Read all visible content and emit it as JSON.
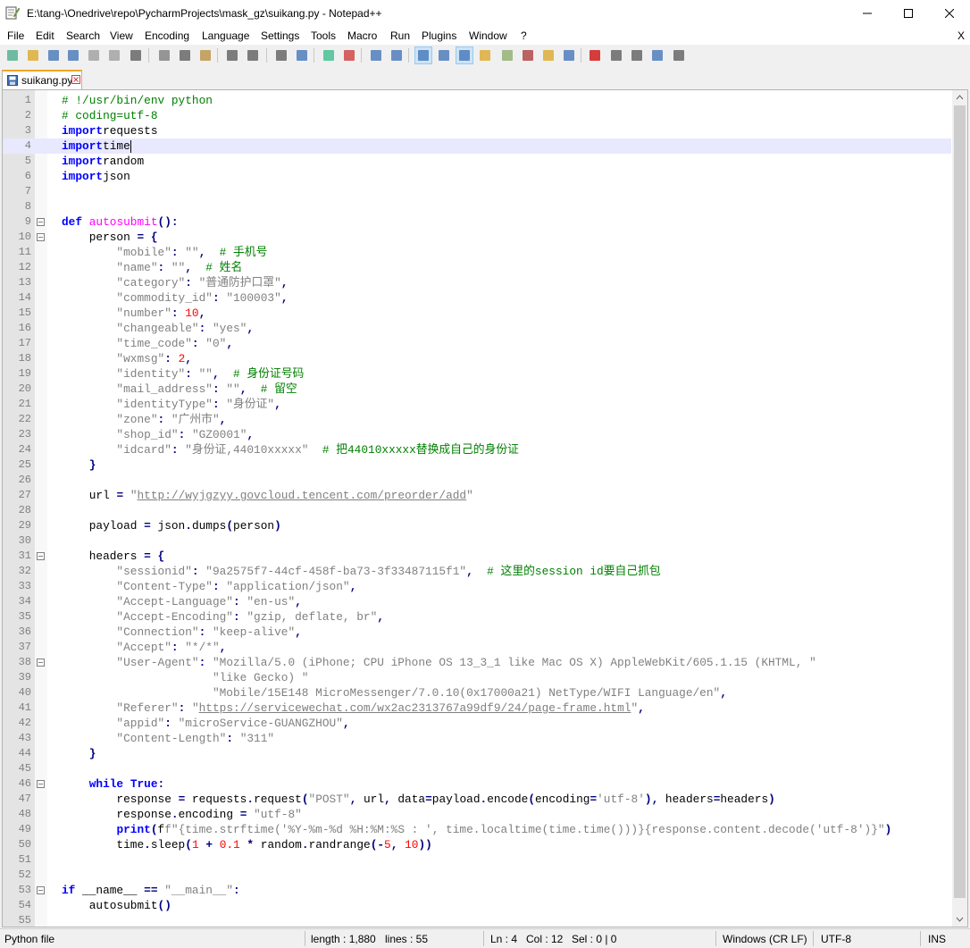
{
  "window": {
    "title": "E:\\tang-\\Onedrive\\repo\\PycharmProjects\\mask_gz\\suikang.py - Notepad++",
    "minimize": "—",
    "maximize": "☐",
    "close": "✕"
  },
  "menu": {
    "items": [
      "File",
      "Edit",
      "Search",
      "View",
      "Encoding",
      "Language",
      "Settings",
      "Tools",
      "Macro",
      "Run",
      "Plugins",
      "Window",
      "?"
    ],
    "close": "X"
  },
  "toolbar": {
    "icons": [
      "new-file",
      "open-file",
      "save",
      "save-all",
      "close",
      "close-all",
      "print",
      "cut",
      "copy",
      "paste",
      "undo",
      "redo",
      "find",
      "replace",
      "zoom-in",
      "zoom-out",
      "sync-vertical",
      "sync-horizontal",
      "word-wrap",
      "show-all-characters",
      "indent-guide",
      "udl",
      "doc-map",
      "function-list",
      "folder-as-workspace",
      "monitoring",
      "record-macro",
      "stop-recording",
      "playback",
      "run-macro-multiple",
      "save-macro"
    ],
    "active_icons": [
      "word-wrap",
      "indent-guide"
    ]
  },
  "tab": {
    "label": "suikang.py"
  },
  "editor": {
    "current_line": 4,
    "lines": [
      [
        [
          "cm",
          "# !/usr/bin/env python"
        ]
      ],
      [
        [
          "cm",
          "# coding=utf-8"
        ]
      ],
      [
        [
          "kw",
          "import"
        ],
        [
          "",
          "requests"
        ]
      ],
      [
        [
          "kw",
          "import"
        ],
        [
          "",
          "time"
        ]
      ],
      [
        [
          "kw",
          "import"
        ],
        [
          "",
          "random"
        ]
      ],
      [
        [
          "kw",
          "import"
        ],
        [
          "",
          "json"
        ]
      ],
      [],
      [],
      [
        [
          "kw",
          "def"
        ],
        [
          "",
          " "
        ],
        [
          "fn",
          "autosubmit"
        ],
        [
          "op",
          "():"
        ]
      ],
      [
        [
          "",
          "    person "
        ],
        [
          "op",
          "="
        ],
        [
          "",
          " "
        ],
        [
          "op",
          "{"
        ]
      ],
      [
        [
          "st",
          "        \"mobile\""
        ],
        [
          "op",
          ":"
        ],
        [
          "",
          " "
        ],
        [
          "st",
          "\"\""
        ],
        [
          "op",
          ","
        ],
        [
          "",
          "  "
        ],
        [
          "cm",
          "# 手机号"
        ]
      ],
      [
        [
          "st",
          "        \"name\""
        ],
        [
          "op",
          ":"
        ],
        [
          "",
          " "
        ],
        [
          "st",
          "\"\""
        ],
        [
          "op",
          ","
        ],
        [
          "",
          "  "
        ],
        [
          "cm",
          "# 姓名"
        ]
      ],
      [
        [
          "st",
          "        \"category\""
        ],
        [
          "op",
          ":"
        ],
        [
          "",
          " "
        ],
        [
          "st",
          "\"普通防护口罩\""
        ],
        [
          "op",
          ","
        ]
      ],
      [
        [
          "st",
          "        \"commodity_id\""
        ],
        [
          "op",
          ":"
        ],
        [
          "",
          " "
        ],
        [
          "st",
          "\"100003\""
        ],
        [
          "op",
          ","
        ]
      ],
      [
        [
          "st",
          "        \"number\""
        ],
        [
          "op",
          ":"
        ],
        [
          "",
          " "
        ],
        [
          "nm",
          "10"
        ],
        [
          "op",
          ","
        ]
      ],
      [
        [
          "st",
          "        \"changeable\""
        ],
        [
          "op",
          ":"
        ],
        [
          "",
          " "
        ],
        [
          "st",
          "\"yes\""
        ],
        [
          "op",
          ","
        ]
      ],
      [
        [
          "st",
          "        \"time_code\""
        ],
        [
          "op",
          ":"
        ],
        [
          "",
          " "
        ],
        [
          "st",
          "\"0\""
        ],
        [
          "op",
          ","
        ]
      ],
      [
        [
          "st",
          "        \"wxmsg\""
        ],
        [
          "op",
          ":"
        ],
        [
          "",
          " "
        ],
        [
          "nm",
          "2"
        ],
        [
          "op",
          ","
        ]
      ],
      [
        [
          "st",
          "        \"identity\""
        ],
        [
          "op",
          ":"
        ],
        [
          "",
          " "
        ],
        [
          "st",
          "\"\""
        ],
        [
          "op",
          ","
        ],
        [
          "",
          "  "
        ],
        [
          "cm",
          "# 身份证号码"
        ]
      ],
      [
        [
          "st",
          "        \"mail_address\""
        ],
        [
          "op",
          ":"
        ],
        [
          "",
          " "
        ],
        [
          "st",
          "\"\""
        ],
        [
          "op",
          ","
        ],
        [
          "",
          "  "
        ],
        [
          "cm",
          "# 留空"
        ]
      ],
      [
        [
          "st",
          "        \"identityType\""
        ],
        [
          "op",
          ":"
        ],
        [
          "",
          " "
        ],
        [
          "st",
          "\"身份证\""
        ],
        [
          "op",
          ","
        ]
      ],
      [
        [
          "st",
          "        \"zone\""
        ],
        [
          "op",
          ":"
        ],
        [
          "",
          " "
        ],
        [
          "st",
          "\"广州市\""
        ],
        [
          "op",
          ","
        ]
      ],
      [
        [
          "st",
          "        \"shop_id\""
        ],
        [
          "op",
          ":"
        ],
        [
          "",
          " "
        ],
        [
          "st",
          "\"GZ0001\""
        ],
        [
          "op",
          ","
        ]
      ],
      [
        [
          "st",
          "        \"idcard\""
        ],
        [
          "op",
          ":"
        ],
        [
          "",
          " "
        ],
        [
          "st",
          "\"身份证,44010xxxxx\""
        ],
        [
          "",
          "  "
        ],
        [
          "cm",
          "# 把44010xxxxx替换成自己的身份证"
        ]
      ],
      [
        [
          "",
          "    "
        ],
        [
          "op",
          "}"
        ]
      ],
      [],
      [
        [
          "",
          "    url "
        ],
        [
          "op",
          "="
        ],
        [
          "",
          " "
        ],
        [
          "st",
          "\""
        ],
        [
          "stul",
          "http://wyjgzyy.govcloud.tencent.com/preorder/add"
        ],
        [
          "st",
          "\""
        ]
      ],
      [],
      [
        [
          "",
          "    payload "
        ],
        [
          "op",
          "="
        ],
        [
          "",
          " json"
        ],
        [
          "op",
          "."
        ],
        [
          "",
          "dumps"
        ],
        [
          "op",
          "("
        ],
        [
          "",
          "person"
        ],
        [
          "op",
          ")"
        ]
      ],
      [],
      [
        [
          "",
          "    headers "
        ],
        [
          "op",
          "="
        ],
        [
          "",
          " "
        ],
        [
          "op",
          "{"
        ]
      ],
      [
        [
          "st",
          "        \"sessionid\""
        ],
        [
          "op",
          ":"
        ],
        [
          "",
          " "
        ],
        [
          "st",
          "\"9a2575f7-44cf-458f-ba73-3f33487115f1\""
        ],
        [
          "op",
          ","
        ],
        [
          "",
          "  "
        ],
        [
          "cm",
          "# 这里的session id要自己抓包"
        ]
      ],
      [
        [
          "st",
          "        \"Content-Type\""
        ],
        [
          "op",
          ":"
        ],
        [
          "",
          " "
        ],
        [
          "st",
          "\"application/json\""
        ],
        [
          "op",
          ","
        ]
      ],
      [
        [
          "st",
          "        \"Accept-Language\""
        ],
        [
          "op",
          ":"
        ],
        [
          "",
          " "
        ],
        [
          "st",
          "\"en-us\""
        ],
        [
          "op",
          ","
        ]
      ],
      [
        [
          "st",
          "        \"Accept-Encoding\""
        ],
        [
          "op",
          ":"
        ],
        [
          "",
          " "
        ],
        [
          "st",
          "\"gzip, deflate, br\""
        ],
        [
          "op",
          ","
        ]
      ],
      [
        [
          "st",
          "        \"Connection\""
        ],
        [
          "op",
          ":"
        ],
        [
          "",
          " "
        ],
        [
          "st",
          "\"keep-alive\""
        ],
        [
          "op",
          ","
        ]
      ],
      [
        [
          "st",
          "        \"Accept\""
        ],
        [
          "op",
          ":"
        ],
        [
          "",
          " "
        ],
        [
          "st",
          "\"*/*\""
        ],
        [
          "op",
          ","
        ]
      ],
      [
        [
          "st",
          "        \"User-Agent\""
        ],
        [
          "op",
          ":"
        ],
        [
          "",
          " "
        ],
        [
          "st",
          "\"Mozilla/5.0 (iPhone; CPU iPhone OS 13_3_1 like Mac OS X) AppleWebKit/605.1.15 (KHTML, \""
        ]
      ],
      [
        [
          "st",
          "                      \"like Gecko) \""
        ]
      ],
      [
        [
          "st",
          "                      \"Mobile/15E148 MicroMessenger/7.0.10(0x17000a21) NetType/WIFI Language/en\""
        ],
        [
          "op",
          ","
        ]
      ],
      [
        [
          "st",
          "        \"Referer\""
        ],
        [
          "op",
          ":"
        ],
        [
          "",
          " "
        ],
        [
          "st",
          "\""
        ],
        [
          "stul",
          "https://servicewechat.com/wx2ac2313767a99df9/24/page-frame.html"
        ],
        [
          "st",
          "\""
        ],
        [
          "op",
          ","
        ]
      ],
      [
        [
          "st",
          "        \"appid\""
        ],
        [
          "op",
          ":"
        ],
        [
          "",
          " "
        ],
        [
          "st",
          "\"microService-GUANGZHOU\""
        ],
        [
          "op",
          ","
        ]
      ],
      [
        [
          "st",
          "        \"Content-Length\""
        ],
        [
          "op",
          ":"
        ],
        [
          "",
          " "
        ],
        [
          "st",
          "\"311\""
        ]
      ],
      [
        [
          "",
          "    "
        ],
        [
          "op",
          "}"
        ]
      ],
      [],
      [
        [
          "",
          "    "
        ],
        [
          "kw",
          "while"
        ],
        [
          "",
          " "
        ],
        [
          "kw",
          "True"
        ],
        [
          "op",
          ":"
        ]
      ],
      [
        [
          "",
          "        response "
        ],
        [
          "op",
          "="
        ],
        [
          "",
          " requests"
        ],
        [
          "op",
          "."
        ],
        [
          "",
          "request"
        ],
        [
          "op",
          "("
        ],
        [
          "st",
          "\"POST\""
        ],
        [
          "op",
          ","
        ],
        [
          "",
          " url"
        ],
        [
          "op",
          ","
        ],
        [
          "",
          " data"
        ],
        [
          "op",
          "="
        ],
        [
          "",
          "payload"
        ],
        [
          "op",
          "."
        ],
        [
          "",
          "encode"
        ],
        [
          "op",
          "("
        ],
        [
          "",
          "encoding"
        ],
        [
          "op",
          "="
        ],
        [
          "st",
          "'utf-8'"
        ],
        [
          "op",
          "),"
        ],
        [
          "",
          " headers"
        ],
        [
          "op",
          "="
        ],
        [
          "",
          "headers"
        ],
        [
          "op",
          ")"
        ]
      ],
      [
        [
          "",
          "        response"
        ],
        [
          "op",
          "."
        ],
        [
          "",
          "encoding "
        ],
        [
          "op",
          "="
        ],
        [
          "",
          " "
        ],
        [
          "st",
          "\"utf-8\""
        ]
      ],
      [
        [
          "",
          "        "
        ],
        [
          "fnb",
          "print"
        ],
        [
          "op",
          "("
        ],
        [
          "",
          "f"
        ],
        [
          "st",
          "f\"{time.strftime('%Y-%m-%d %H:%M:%S : ', time.localtime(time.time()))}{response.content.decode('utf-8')}\""
        ],
        [
          "op",
          ")"
        ]
      ],
      [
        [
          "",
          "        time"
        ],
        [
          "op",
          "."
        ],
        [
          "",
          "sleep"
        ],
        [
          "op",
          "("
        ],
        [
          "nm",
          "1"
        ],
        [
          "",
          " "
        ],
        [
          "op",
          "+"
        ],
        [
          "",
          " "
        ],
        [
          "nm",
          "0.1"
        ],
        [
          "",
          " "
        ],
        [
          "op",
          "*"
        ],
        [
          "",
          " random"
        ],
        [
          "op",
          "."
        ],
        [
          "",
          "randrange"
        ],
        [
          "op",
          "(-"
        ],
        [
          "nm",
          "5"
        ],
        [
          "op",
          ","
        ],
        [
          "",
          " "
        ],
        [
          "nm",
          "10"
        ],
        [
          "op",
          "))"
        ]
      ],
      [],
      [],
      [
        [
          "kw",
          "if"
        ],
        [
          "",
          " __name__ "
        ],
        [
          "op",
          "=="
        ],
        [
          "",
          " "
        ],
        [
          "st",
          "\"__main__\""
        ],
        [
          "op",
          ":"
        ]
      ],
      [
        [
          "",
          "    autosubmit"
        ],
        [
          "op",
          "()"
        ]
      ],
      []
    ],
    "fold_lines": [
      9,
      10,
      31,
      38,
      46,
      53
    ]
  },
  "status": {
    "file_type": "Python file",
    "length": "length : 1,880",
    "lines": "lines : 55",
    "ln": "Ln : 4",
    "col": "Col : 12",
    "sel": "Sel : 0 | 0",
    "eol": "Windows (CR LF)",
    "encoding": "UTF-8",
    "mode": "INS"
  }
}
